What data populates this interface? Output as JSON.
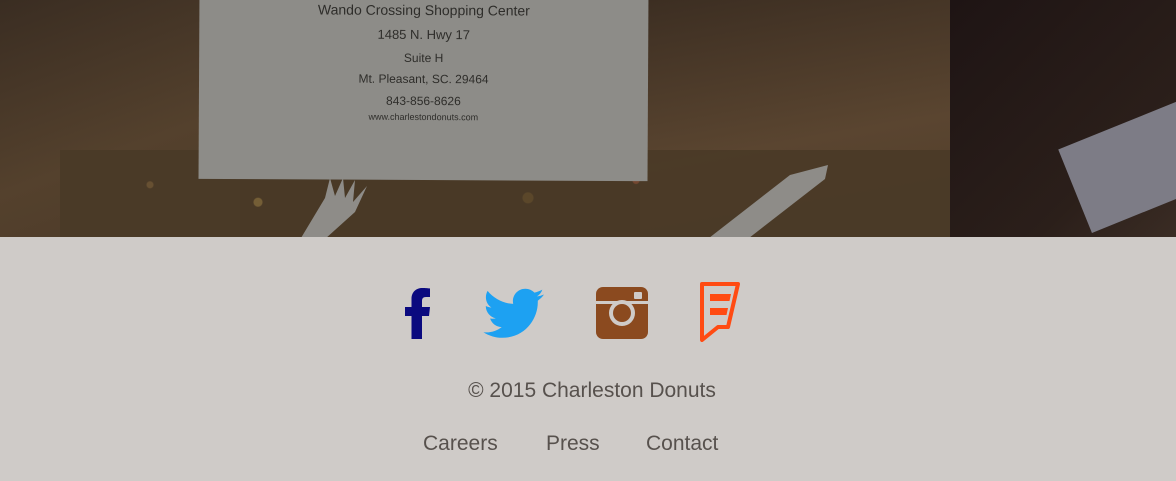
{
  "hero": {
    "card_lines": [
      "Wando Crossing Shopping Center",
      "1485 N. Hwy 17",
      "Suite H",
      "Mt. Pleasant, SC. 29464",
      "843-856-8626",
      "www.charlestondonuts.com"
    ]
  },
  "social": [
    {
      "name": "facebook-icon",
      "color": "#0b0a7f"
    },
    {
      "name": "twitter-icon",
      "color": "#1da1f2"
    },
    {
      "name": "instagram-icon",
      "color": "#8b4a1f"
    },
    {
      "name": "foursquare-icon",
      "color": "#ff4b13"
    }
  ],
  "footer": {
    "copyright": "© 2015 Charleston Donuts",
    "links": {
      "careers": "Careers",
      "press": "Press",
      "contact": "Contact"
    }
  },
  "colors": {
    "footer_bg": "#cfcbc8",
    "footer_text": "#57514d"
  }
}
